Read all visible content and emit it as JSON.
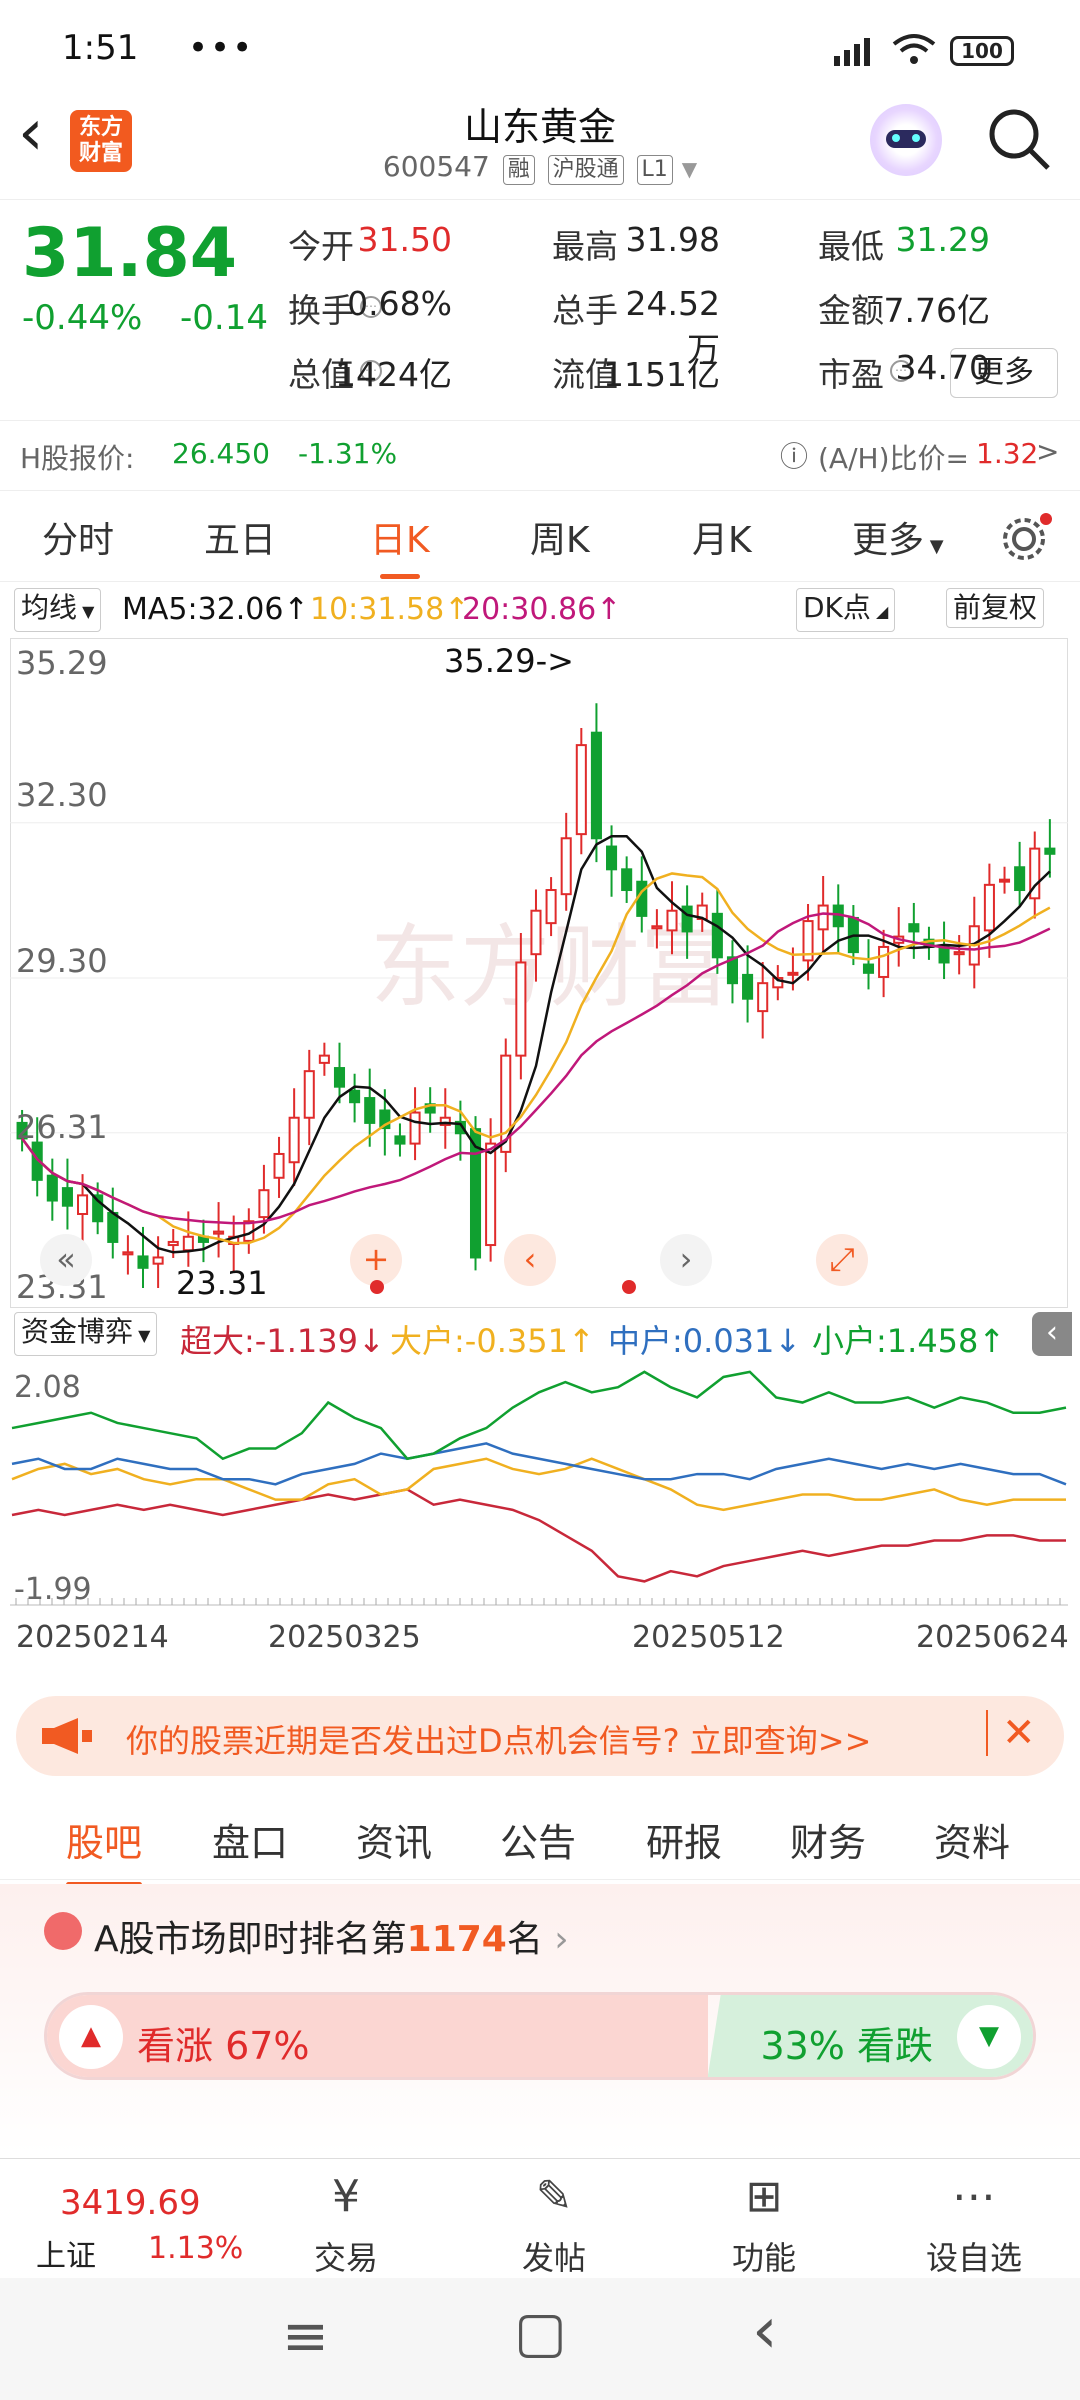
{
  "status": {
    "time": "1:51",
    "dots": "•••",
    "battery": "100"
  },
  "header": {
    "back": "‹",
    "logo": "东方\n财富",
    "title": "山东黄金",
    "code": "600547",
    "tags": [
      "融",
      "沪股通",
      "L1"
    ]
  },
  "quote": {
    "price": "31.84",
    "change_pct": "-0.44%",
    "change": "-0.14",
    "rows": [
      [
        {
          "label": "今开",
          "value": "31.50",
          "color": "red"
        },
        {
          "label": "最高",
          "value": "31.98",
          "color": "black"
        },
        {
          "label": "最低",
          "value": "31.29",
          "color": "green"
        }
      ],
      [
        {
          "label": "换手",
          "value": "0.68%",
          "color": "black"
        },
        {
          "label": "总手",
          "value": "24.52万",
          "color": "black"
        },
        {
          "label": "金额",
          "value": "7.76亿",
          "color": "black"
        }
      ],
      [
        {
          "label": "总值",
          "value": "1424亿",
          "color": "black"
        },
        {
          "label": "流值",
          "value": "1151亿",
          "color": "black"
        },
        {
          "label": "市盈",
          "value": "34.70",
          "color": "black"
        }
      ]
    ],
    "more": "更多",
    "hshare_label": "H股报价:",
    "hshare_price": "26.450",
    "hshare_pct": "-1.31%",
    "ah_label": "(A/H)比价=",
    "ah_value": "1.32",
    "ah_arrow": ">"
  },
  "chart_tabs": [
    "分时",
    "五日",
    "日K",
    "周K",
    "月K",
    "更多"
  ],
  "active_chart_tab": "日K",
  "ma": {
    "selector": "均线",
    "ma5": "MA5:32.06↑",
    "ma10": "10:31.58↑",
    "ma20": "20:30.86↑",
    "dk": "DK点",
    "adjust": "前复权",
    "colors": {
      "ma5": "#111111",
      "ma10": "#f0b020",
      "ma20": "#c0187a"
    }
  },
  "chart_data": {
    "type": "candlestick",
    "ylabels": [
      "35.29",
      "32.30",
      "29.30",
      "26.31",
      "23.31"
    ],
    "ylim": [
      23.31,
      35.29
    ],
    "high_annotation": "35.29->",
    "low_annotation": "23.31",
    "x_dates": [
      "20250214",
      "20250325",
      "20250512",
      "20250624"
    ],
    "closes": [
      26.2,
      25.4,
      25.0,
      24.9,
      25.1,
      24.6,
      24.2,
      24.0,
      23.7,
      23.9,
      24.2,
      24.3,
      24.2,
      24.4,
      24.3,
      24.6,
      25.2,
      25.9,
      26.6,
      27.5,
      27.8,
      27.2,
      26.9,
      26.5,
      26.4,
      26.1,
      26.7,
      26.7,
      26.6,
      26.3,
      23.9,
      26.1,
      27.8,
      29.6,
      30.6,
      31.0,
      32.0,
      33.8,
      32.0,
      31.4,
      31.0,
      30.5,
      30.3,
      30.6,
      30.2,
      30.7,
      29.7,
      29.2,
      28.9,
      29.2,
      29.3,
      29.4,
      30.4,
      30.7,
      30.3,
      29.8,
      29.4,
      29.9,
      30.1,
      30.2,
      29.9,
      29.6,
      29.8,
      30.3,
      31.1,
      31.2,
      31.0,
      31.8,
      31.7
    ]
  },
  "fund": {
    "selector": "资金博弈",
    "super": "超大:-1.139↓",
    "large": "大户:-0.351↑",
    "medium": "中户:0.031↓",
    "small": "小户:1.458↑",
    "ymax": "2.08",
    "ymin": "-1.99",
    "series": {
      "super": [
        -0.6,
        -0.5,
        -0.6,
        -0.5,
        -0.4,
        -0.5,
        -0.4,
        -0.5,
        -0.6,
        -0.5,
        -0.4,
        -0.3,
        -0.2,
        -0.3,
        -0.2,
        -0.1,
        -0.4,
        -0.3,
        -0.4,
        -0.5,
        -0.7,
        -1.0,
        -1.3,
        -1.8,
        -1.9,
        -1.7,
        -1.8,
        -1.6,
        -1.5,
        -1.4,
        -1.3,
        -1.4,
        -1.3,
        -1.2,
        -1.2,
        -1.1,
        -1.1,
        -1.0,
        -1.0,
        -1.1,
        -1.1
      ],
      "large": [
        0.1,
        0.3,
        0.4,
        0.2,
        0.3,
        0.1,
        0.0,
        0.1,
        0.1,
        -0.1,
        -0.3,
        -0.3,
        0.0,
        0.1,
        -0.2,
        -0.1,
        0.3,
        0.4,
        0.5,
        0.3,
        0.2,
        0.3,
        0.5,
        0.3,
        0.1,
        -0.1,
        -0.4,
        -0.5,
        -0.4,
        -0.3,
        -0.2,
        -0.2,
        -0.3,
        -0.3,
        -0.2,
        -0.1,
        -0.3,
        -0.4,
        -0.3,
        -0.3,
        -0.3
      ],
      "medium": [
        0.4,
        0.5,
        0.3,
        0.3,
        0.5,
        0.4,
        0.3,
        0.3,
        0.1,
        0.1,
        0.0,
        0.2,
        0.3,
        0.4,
        0.6,
        0.5,
        0.6,
        0.7,
        0.8,
        0.6,
        0.5,
        0.4,
        0.3,
        0.2,
        0.1,
        0.1,
        0.2,
        0.2,
        0.1,
        0.3,
        0.4,
        0.5,
        0.4,
        0.3,
        0.4,
        0.3,
        0.4,
        0.3,
        0.2,
        0.2,
        0.0
      ],
      "small": [
        1.1,
        1.2,
        1.3,
        1.4,
        1.2,
        1.1,
        1.0,
        0.9,
        0.5,
        0.7,
        0.7,
        1.0,
        1.6,
        1.3,
        1.1,
        0.5,
        0.6,
        0.9,
        1.1,
        1.5,
        1.8,
        2.0,
        1.8,
        1.9,
        2.2,
        1.9,
        1.7,
        2.1,
        2.2,
        1.7,
        1.6,
        1.8,
        1.6,
        1.6,
        1.7,
        1.5,
        1.7,
        1.6,
        1.4,
        1.4,
        1.5
      ]
    }
  },
  "banner": {
    "text": "你的股票近期是否发出过D点机会信号? 立即查询>>",
    "close": "✕"
  },
  "bottom_tabs": [
    "股吧",
    "盘口",
    "资讯",
    "公告",
    "研报",
    "财务",
    "资料"
  ],
  "active_bottom_tab": "股吧",
  "sentiment": {
    "rank_prefix": "A股市场即时排名第",
    "rank_value": "1174",
    "rank_suffix": "名",
    "up_label": "看涨 67%",
    "down_label": "33% 看跌",
    "up_fraction": 0.67
  },
  "bottom_nav": {
    "index_value": "3419.69",
    "index_name": "上证",
    "index_pct": "1.13%",
    "items": [
      {
        "label": "交易",
        "icon": "¥"
      },
      {
        "label": "发帖",
        "icon": "✎"
      },
      {
        "label": "功能",
        "icon": "⊞"
      },
      {
        "label": "设自选",
        "icon": "⋯"
      }
    ]
  },
  "sys_nav": [
    "≡",
    "▢",
    "‹"
  ]
}
